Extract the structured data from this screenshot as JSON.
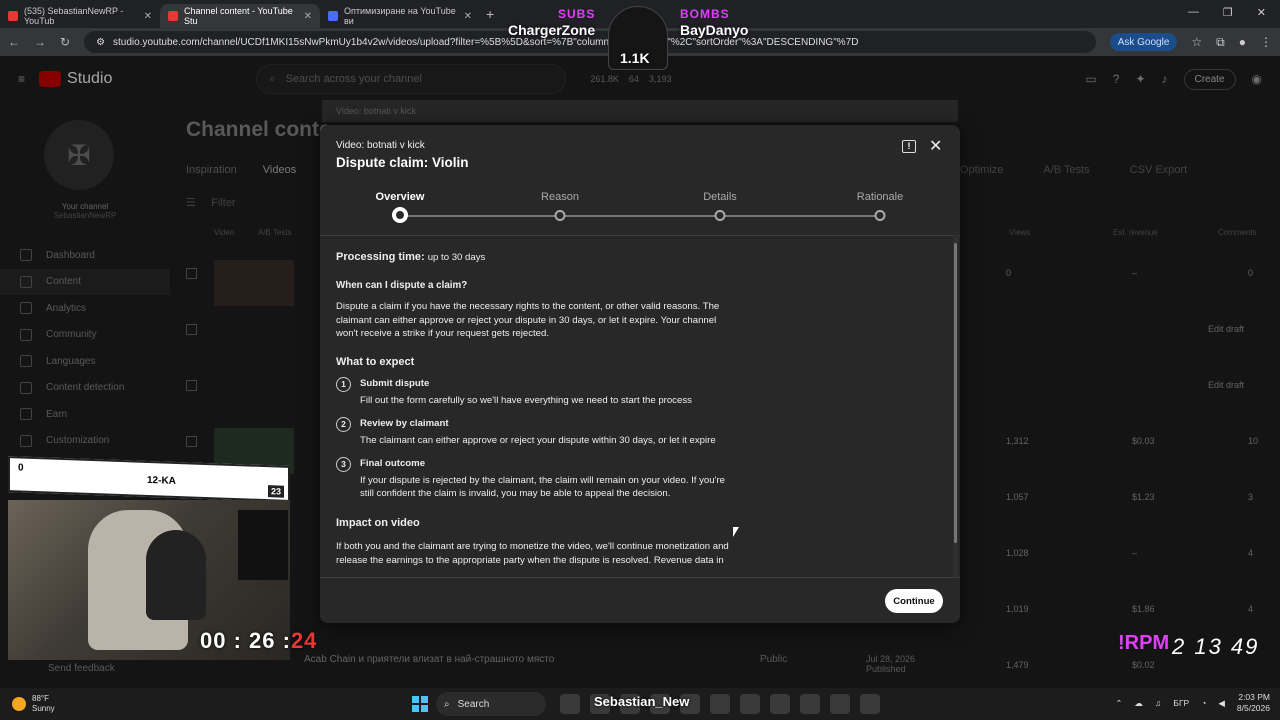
{
  "browser": {
    "tabs": [
      {
        "title": "(535) SebastianNewRP - YouTub"
      },
      {
        "title": "Channel content - YouTube Stu"
      },
      {
        "title": "Оптимизиране на YouTube ви"
      }
    ],
    "url": "studio.youtube.com/channel/UCDf1MKI15sNwPkmUy1b4v2w/videos/upload?filter=%5B%5D&sort=%7B\"columnType\"%3A\"...\"%2C\"sortOrder\"%3A\"DESCENDING\"%7D",
    "ask_google": "Ask Google"
  },
  "studio": {
    "logo": "Studio",
    "search_placeholder": "Search across your channel",
    "stats": [
      "261.8K",
      "64",
      "3,193"
    ],
    "create": "Create",
    "your_channel": "Your channel",
    "channel_name": "SebastianNewRP",
    "nav": [
      "Dashboard",
      "Content",
      "Analytics",
      "Community",
      "Languages",
      "Content detection",
      "Earn",
      "Customization"
    ],
    "send_feedback": "Send feedback",
    "page_title": "Channel conte",
    "tabs": [
      "Inspiration",
      "Videos"
    ],
    "tabs_right": [
      "Optimize",
      "A/B Tests",
      "CSV Export"
    ],
    "filter": "Filter",
    "columns": {
      "video": "Video",
      "ab": "A/B Tests",
      "views": "Views",
      "revenue": "Est. revenue",
      "comments": "Comments"
    },
    "rows": [
      {
        "views": "0",
        "revenue": "–",
        "comments": "0",
        "edit": ""
      },
      {
        "views": "",
        "revenue": "",
        "comments": "",
        "edit": "Edit draft"
      },
      {
        "views": "",
        "revenue": "",
        "comments": "",
        "edit": "Edit draft"
      },
      {
        "views": "1,312",
        "revenue": "$0.03",
        "comments": "10",
        "edit": ""
      },
      {
        "views": "1,057",
        "revenue": "$1.23",
        "comments": "3",
        "edit": ""
      },
      {
        "views": "1,028",
        "revenue": "–",
        "comments": "4",
        "edit": ""
      },
      {
        "views": "1,019",
        "revenue": "$1.86",
        "comments": "4",
        "edit": ""
      }
    ],
    "last_row": {
      "title": "Acab Chain и приятели влизат в най-страшното място",
      "visibility": "Public",
      "date": "Jul 28, 2026",
      "status": "Published",
      "views": "1,479",
      "revenue": "$0.02"
    }
  },
  "modal": {
    "ghost_label": "Video: botnati v kick",
    "video_label": "Video: botnati v kick",
    "title": "Dispute claim: Violin",
    "steps": [
      "Overview",
      "Reason",
      "Details",
      "Rationale"
    ],
    "processing_label": "Processing time:",
    "processing_value": "up to 30 days",
    "when_heading": "When can I dispute a claim?",
    "when_text": "Dispute a claim if you have the necessary rights to the content, or other valid reasons. The claimant can either approve or reject your dispute in 30 days, or let it expire. Your channel won't receive a strike if your request gets rejected.",
    "expect_heading": "What to expect",
    "expect_items": [
      {
        "num": "1",
        "title": "Submit dispute",
        "desc": "Fill out the form carefully so we'll have everything we need to start the process"
      },
      {
        "num": "2",
        "title": "Review by claimant",
        "desc": "The claimant can either approve or reject your dispute within 30 days, or let it expire"
      },
      {
        "num": "3",
        "title": "Final outcome",
        "desc": "If your dispute is rejected by the claimant, the claim will remain on your video. If you're still confident the claim is invalid, you may be able to appeal the decision."
      }
    ],
    "impact_heading": "Impact on video",
    "impact_text": "If both you and the claimant are trying to monetize the video, we'll continue monetization and release the earnings to the appropriate party when the dispute is resolved. Revenue data in",
    "continue": "Continue"
  },
  "overlay": {
    "subs_label": "SUBS",
    "bombs_label": "BOMBS",
    "subs_name": "ChargerZone",
    "bombs_name": "BayDanyo",
    "count": "1.1K",
    "cam_left": "0",
    "cam_title": "12-KA",
    "cam_right": "23",
    "timer_a": "00 : 26 :",
    "timer_b": "24",
    "rpm_label": "!RPM",
    "rpm_values": "2 13 49",
    "streamer": "Sebastian_New"
  },
  "taskbar": {
    "temp": "88°F",
    "weather": "Sunny",
    "search": "Search",
    "lang": "БГР",
    "time": "2:03 PM",
    "date": "8/5/2026"
  }
}
